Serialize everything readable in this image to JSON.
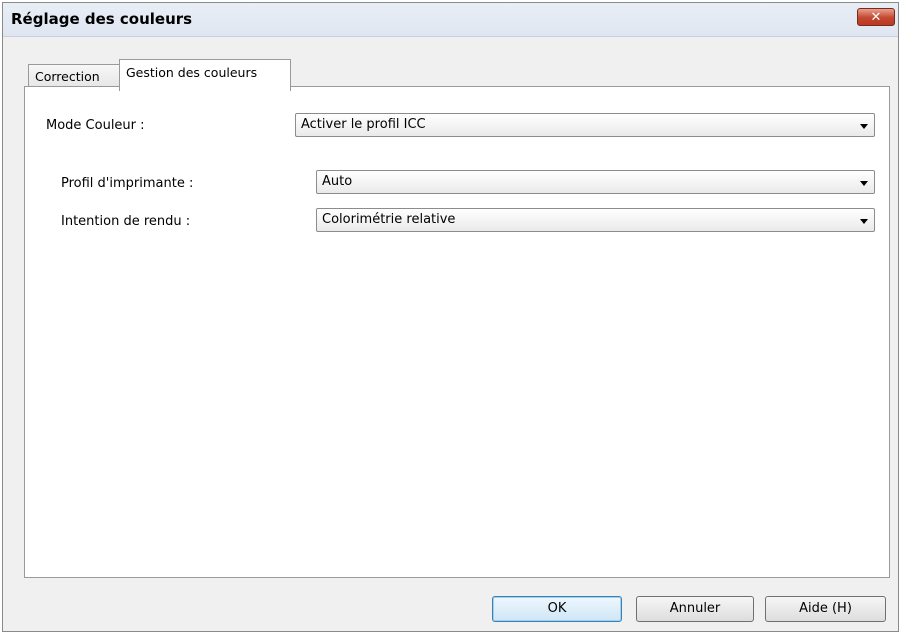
{
  "window": {
    "title": "Réglage des couleurs",
    "close_glyph": "✕"
  },
  "tabs": [
    {
      "label": "Correction",
      "active": false
    },
    {
      "label": "Gestion des couleurs",
      "active": true
    }
  ],
  "form": {
    "mode_couleur": {
      "label": "Mode Couleur :",
      "value": "Activer le profil ICC"
    },
    "profil": {
      "label": "Profil d'imprimante :",
      "value": "Auto"
    },
    "intention": {
      "label": "Intention de rendu :",
      "value": "Colorimétrie relative"
    }
  },
  "buttons": {
    "ok": "OK",
    "cancel": "Annuler",
    "help": "Aide (H)"
  },
  "icons": {
    "close": "close-icon",
    "dropdown": "chevron-down-icon"
  }
}
